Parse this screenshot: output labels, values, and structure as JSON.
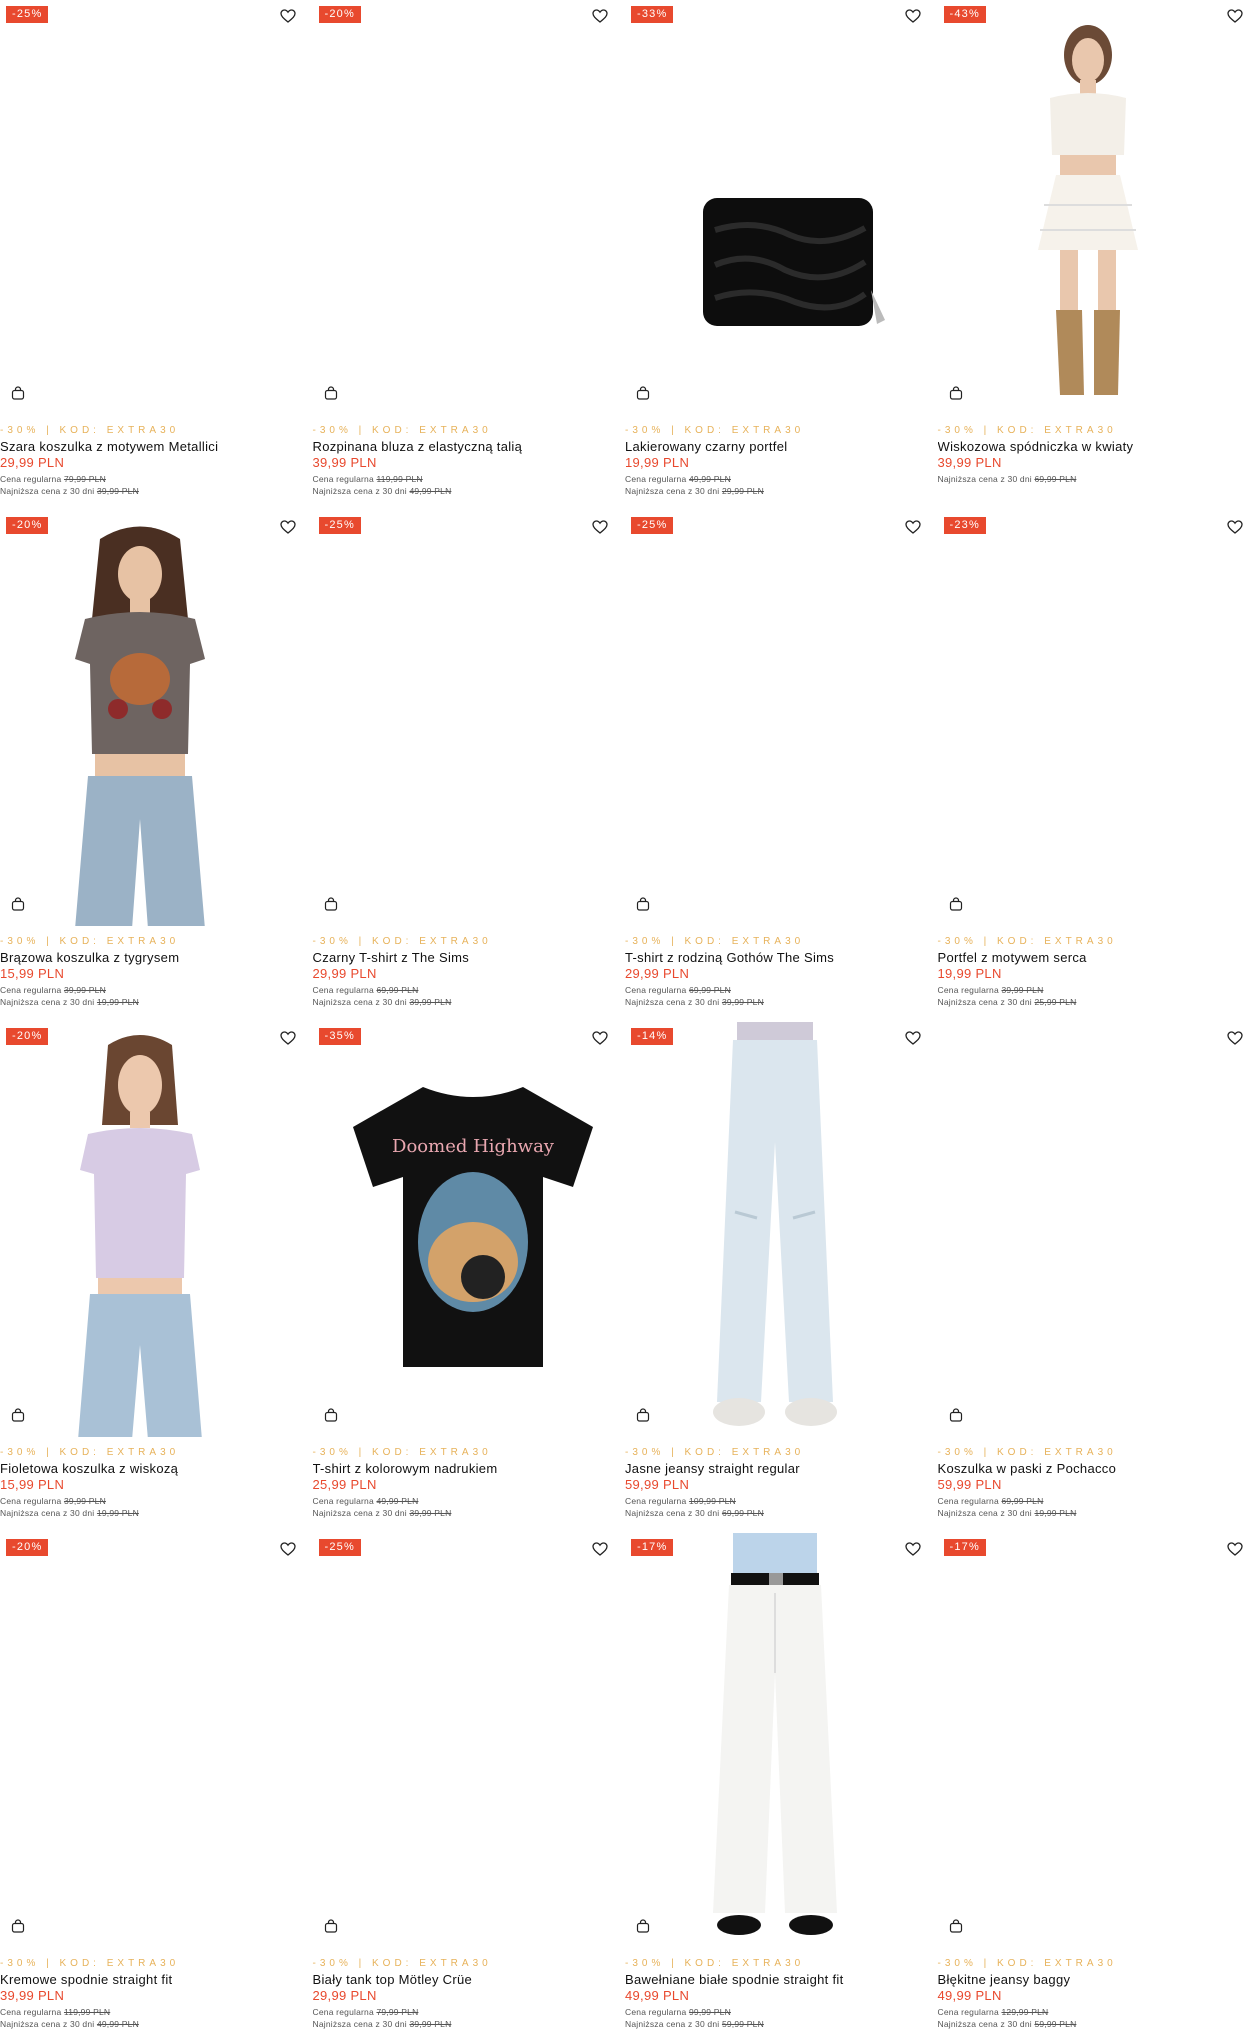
{
  "products": [
    {
      "badge": "-25%",
      "promo": "-30% | KOD: EXTRA30",
      "name": "Szara koszulka z motywem Metallici",
      "price": "29,99 PLN",
      "regular_label": "Cena regularna",
      "regular": "79,99 PLN",
      "lowest_label": "Najniższa cena z 30 dni",
      "lowest": "39,99 PLN",
      "image": "none"
    },
    {
      "badge": "-20%",
      "promo": "-30% | KOD: EXTRA30",
      "name": "Rozpinana bluza z elastyczną talią",
      "price": "39,99 PLN",
      "regular_label": "Cena regularna",
      "regular": "119,99 PLN",
      "lowest_label": "Najniższa cena z 30 dni",
      "lowest": "49,99 PLN",
      "image": "none"
    },
    {
      "badge": "-33%",
      "promo": "-30% | KOD: EXTRA30",
      "name": "Lakierowany czarny portfel",
      "price": "19,99 PLN",
      "regular_label": "Cena regularna",
      "regular": "49,99 PLN",
      "lowest_label": "Najniższa cena z 30 dni",
      "lowest": "29,99 PLN",
      "image": "wallet"
    },
    {
      "badge": "-43%",
      "promo": "-30% | KOD: EXTRA30",
      "name": "Wiskozowa spódniczka w kwiaty",
      "price": "39,99 PLN",
      "regular_label": "",
      "regular": "",
      "lowest_label": "Najniższa cena z 30 dni",
      "lowest": "69,99 PLN",
      "image": "model-skirt"
    },
    {
      "badge": "-20%",
      "promo": "-30% | KOD: EXTRA30",
      "name": "Brązowa koszulka z tygrysem",
      "price": "15,99 PLN",
      "regular_label": "Cena regularna",
      "regular": "39,99 PLN",
      "lowest_label": "Najniższa cena z 30 dni",
      "lowest": "19,99 PLN",
      "image": "model-tiger"
    },
    {
      "badge": "-25%",
      "promo": "-30% | KOD: EXTRA30",
      "name": "Czarny T-shirt z The Sims",
      "price": "29,99 PLN",
      "regular_label": "Cena regularna",
      "regular": "69,99 PLN",
      "lowest_label": "Najniższa cena z 30 dni",
      "lowest": "39,99 PLN",
      "image": "none"
    },
    {
      "badge": "-25%",
      "promo": "-30% | KOD: EXTRA30",
      "name": "T-shirt z rodziną Gothów The Sims",
      "price": "29,99 PLN",
      "regular_label": "Cena regularna",
      "regular": "69,99 PLN",
      "lowest_label": "Najniższa cena z 30 dni",
      "lowest": "39,99 PLN",
      "image": "none"
    },
    {
      "badge": "-23%",
      "promo": "-30% | KOD: EXTRA30",
      "name": "Portfel z motywem serca",
      "price": "19,99 PLN",
      "regular_label": "Cena regularna",
      "regular": "39,99 PLN",
      "lowest_label": "Najniższa cena z 30 dni",
      "lowest": "25,99 PLN",
      "image": "none"
    },
    {
      "badge": "-20%",
      "promo": "-30% | KOD: EXTRA30",
      "name": "Fioletowa koszulka z wiskozą",
      "price": "15,99 PLN",
      "regular_label": "Cena regularna",
      "regular": "39,99 PLN",
      "lowest_label": "Najniższa cena z 30 dni",
      "lowest": "19,99 PLN",
      "image": "model-lilac"
    },
    {
      "badge": "-35%",
      "promo": "-30% | KOD: EXTRA30",
      "name": "T-shirt z kolorowym nadrukiem",
      "price": "25,99 PLN",
      "regular_label": "Cena regularna",
      "regular": "49,99 PLN",
      "lowest_label": "Najniższa cena z 30 dni",
      "lowest": "39,99 PLN",
      "image": "black-tee"
    },
    {
      "badge": "-14%",
      "promo": "-30% | KOD: EXTRA30",
      "name": "Jasne jeansy straight regular",
      "price": "59,99 PLN",
      "regular_label": "Cena regularna",
      "regular": "109,99 PLN",
      "lowest_label": "Najniższa cena z 30 dni",
      "lowest": "69,99 PLN",
      "image": "jeans"
    },
    {
      "badge": "",
      "promo": "-30% | KOD: EXTRA30",
      "name": "Koszulka w paski z Pochacco",
      "price": "59,99 PLN",
      "regular_label": "Cena regularna",
      "regular": "69,99 PLN",
      "lowest_label": "Najniższa cena z 30 dni",
      "lowest": "19,99 PLN",
      "image": "none"
    },
    {
      "badge": "-20%",
      "promo": "-30% | KOD: EXTRA30",
      "name": "Kremowe spodnie straight fit",
      "price": "39,99 PLN",
      "regular_label": "Cena regularna",
      "regular": "119,99 PLN",
      "lowest_label": "Najniższa cena z 30 dni",
      "lowest": "49,99 PLN",
      "image": "none"
    },
    {
      "badge": "-25%",
      "promo": "-30% | KOD: EXTRA30",
      "name": "Biały tank top Mötley Crüe",
      "price": "29,99 PLN",
      "regular_label": "Cena regularna",
      "regular": "79,99 PLN",
      "lowest_label": "Najniższa cena z 30 dni",
      "lowest": "39,99 PLN",
      "image": "none"
    },
    {
      "badge": "-17%",
      "promo": "-30% | KOD: EXTRA30",
      "name": "Bawełniane białe spodnie straight fit",
      "price": "49,99 PLN",
      "regular_label": "Cena regularna",
      "regular": "99,99 PLN",
      "lowest_label": "Najniższa cena z 30 dni",
      "lowest": "59,99 PLN",
      "image": "white-pants"
    },
    {
      "badge": "-17%",
      "promo": "-30% | KOD: EXTRA30",
      "name": "Błękitne jeansy baggy",
      "price": "49,99 PLN",
      "regular_label": "Cena regularna",
      "regular": "129,99 PLN",
      "lowest_label": "Najniższa cena z 30 dni",
      "lowest": "59,99 PLN",
      "image": "none"
    }
  ],
  "colors": {
    "accent": "#e8492e",
    "promo": "#e7b25a"
  },
  "icons": {
    "wishlist": "heart-outline-icon",
    "cart": "shopping-bag-icon"
  }
}
